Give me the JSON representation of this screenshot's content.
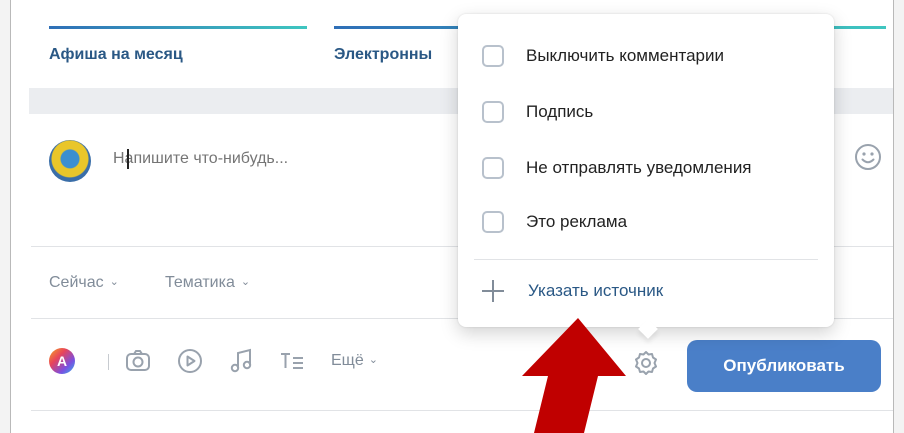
{
  "tabs": [
    {
      "label": "Афиша на месяц"
    },
    {
      "label": "Электронны"
    }
  ],
  "composer": {
    "placeholder": "Напишите что-нибудь..."
  },
  "meta": {
    "time": "Сейчас",
    "topic": "Тематика"
  },
  "toolbar": {
    "more": "Ещё",
    "publish": "Опубликовать"
  },
  "settings_menu": {
    "options": [
      {
        "label": "Выключить комментарии",
        "checked": false
      },
      {
        "label": "Подпись",
        "checked": false
      },
      {
        "label": "Не отправлять уведомления",
        "checked": false
      },
      {
        "label": "Это реклама",
        "checked": false
      }
    ],
    "source_label": "Указать источник"
  },
  "colors": {
    "accent": "#4a7fc8",
    "link": "#2a5885",
    "muted": "#818c99",
    "arrow": "#c00000"
  },
  "icons": [
    "avatar",
    "emoji-icon",
    "color-palette-icon",
    "camera-icon",
    "video-icon",
    "music-icon",
    "text-format-icon",
    "gear-icon",
    "plus-icon",
    "red-arrow"
  ]
}
